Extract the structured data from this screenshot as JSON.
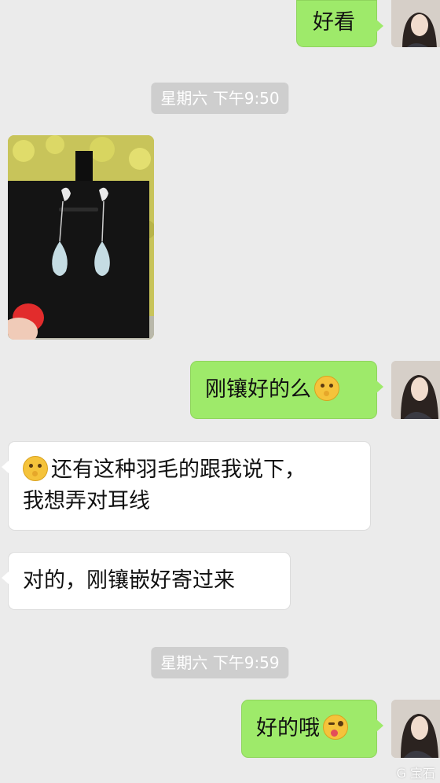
{
  "messages": {
    "m1": "好看",
    "m2": "刚镶好的么",
    "m3_line1": "还有这种羽毛的跟我说下，",
    "m3_line2": "我想弄对耳线",
    "m4": "对的，刚镶嵌好寄过来",
    "m5": "好的哦"
  },
  "timestamps": {
    "t1": "星期六 下午9:50",
    "t2": "星期六 下午9:59"
  },
  "icons": {
    "think_emoji": "thinking-face-emoji",
    "wink_emoji": "winking-tongue-emoji",
    "avatar": "user-avatar"
  },
  "watermark": "G 宝石",
  "colors": {
    "background": "#ebebeb",
    "my_bubble": "#9eea6a",
    "their_bubble": "#ffffff",
    "time_pill": "#cecece"
  }
}
